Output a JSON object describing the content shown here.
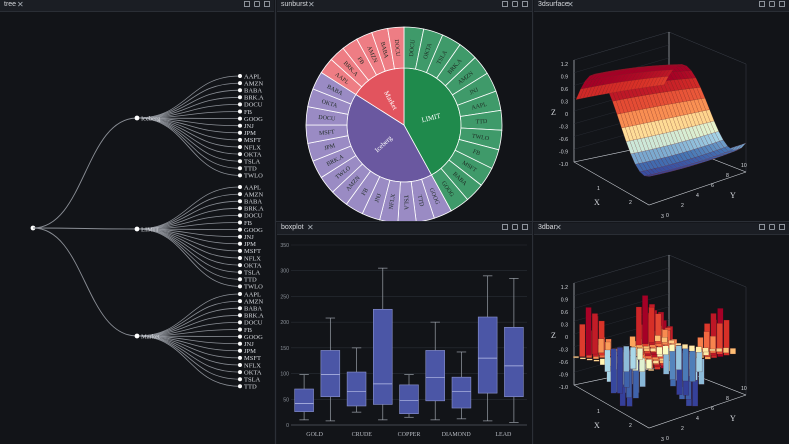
{
  "panels": {
    "tree": {
      "title": "tree"
    },
    "sunburst": {
      "title": "sunburst"
    },
    "surface": {
      "title": "3dsurface"
    },
    "boxplot": {
      "title": "boxplot"
    },
    "bar3d": {
      "title": "3dbar"
    }
  },
  "icons": [
    "close-icon",
    "restore-icon",
    "popout-icon",
    "maximize-icon"
  ],
  "chart_data": [
    {
      "type": "tree",
      "root": "",
      "branches": [
        {
          "name": "Iceberg",
          "children": [
            "AAPL",
            "AMZN",
            "BABA",
            "BRK.A",
            "DOCU",
            "FB",
            "GOOG",
            "JNJ",
            "JPM",
            "MSFT",
            "NFLX",
            "OKTA",
            "TSLA",
            "TTD",
            "TWLO"
          ]
        },
        {
          "name": "LIMIT",
          "children": [
            "AAPL",
            "AMZN",
            "BABA",
            "BRK.A",
            "DOCU",
            "FB",
            "GOOG",
            "JNJ",
            "JPM",
            "MSFT",
            "NFLX",
            "OKTA",
            "TSLA",
            "TTD",
            "TWLO"
          ]
        },
        {
          "name": "Market",
          "children": [
            "AAPL",
            "AMZN",
            "BABA",
            "BRK.A",
            "DOCU",
            "FB",
            "GOOG",
            "JNJ",
            "JPM",
            "MSFT",
            "NFLX",
            "OKTA",
            "TSLA",
            "TTD"
          ]
        }
      ]
    },
    {
      "type": "sunburst",
      "inner": [
        {
          "name": "LIMIT",
          "color": "#1f8a4c",
          "share": 0.42
        },
        {
          "name": "Iceberg",
          "color": "#6a58a0",
          "share": 0.42
        },
        {
          "name": "Market",
          "color": "#e2545e",
          "share": 0.16
        }
      ],
      "outer": [
        {
          "parent": "LIMIT",
          "color": "#3f9a6a",
          "labels": [
            "DOCU",
            "OKTA",
            "TSLA",
            "BRK.A",
            "AMZN",
            "JNJ",
            "AAPL",
            "TTD",
            "TWLO",
            "FB",
            "MSFT",
            "BABA",
            "GOOG"
          ]
        },
        {
          "parent": "Iceberg",
          "color": "#9a8bc4",
          "labels": [
            "GOOG",
            "TTD",
            "TSLA",
            "NFLX",
            "JNJ",
            "FB",
            "AMZN",
            "TWLO",
            "BRK.A",
            "JPM",
            "MSFT",
            "DOCU",
            "OKTA",
            "BABA"
          ]
        },
        {
          "parent": "Market",
          "color": "#ee7d84",
          "labels": [
            "AAPL",
            "BRK.A",
            "FB",
            "AMZN",
            "BABA",
            "DOCU"
          ]
        }
      ]
    },
    {
      "type": "surface",
      "zlabel": "Z",
      "xlabel": "X",
      "ylabel": "Y",
      "zticks": [
        "1.2",
        "0.9",
        "0.6",
        "0.3",
        "0",
        "-0.3",
        "-0.6",
        "-0.9",
        "-1.0"
      ],
      "xticks": [
        "1",
        "2",
        "3"
      ],
      "yticks": [
        "0",
        "2",
        "4",
        "6",
        "8",
        "10"
      ]
    },
    {
      "type": "box",
      "categories": [
        "GOLD",
        "CRUDE",
        "COPPER",
        "DIAMOND",
        "LEAD"
      ],
      "ylim": [
        0,
        350
      ],
      "yticks": [
        "350",
        "300",
        "250",
        "200",
        "150",
        "100",
        "50",
        "0"
      ],
      "boxes": [
        {
          "min": 10,
          "q1": 26,
          "median": 42,
          "q3": 70,
          "max": 98
        },
        {
          "min": 8,
          "q1": 55,
          "median": 98,
          "q3": 145,
          "max": 208
        },
        {
          "min": 25,
          "q1": 37,
          "median": 65,
          "q3": 103,
          "max": 150
        },
        {
          "min": 10,
          "q1": 40,
          "median": 80,
          "q3": 225,
          "max": 305
        },
        {
          "min": 15,
          "q1": 22,
          "median": 48,
          "q3": 78,
          "max": 98
        },
        {
          "min": 10,
          "q1": 47,
          "median": 92,
          "q3": 145,
          "max": 200
        },
        {
          "min": 12,
          "q1": 33,
          "median": 65,
          "q3": 93,
          "max": 142
        },
        {
          "min": 8,
          "q1": 62,
          "median": 130,
          "q3": 210,
          "max": 290
        },
        {
          "min": 5,
          "q1": 55,
          "median": 115,
          "q3": 190,
          "max": 285
        }
      ]
    },
    {
      "type": "bar3d",
      "zlabel": "Z",
      "xlabel": "X",
      "ylabel": "Y",
      "zticks": [
        "1.2",
        "0.9",
        "0.6",
        "0.3",
        "0",
        "-0.3",
        "-0.6",
        "-0.9",
        "-1.0"
      ],
      "xticks": [
        "1",
        "2",
        "3"
      ],
      "yticks": [
        "0",
        "2",
        "4",
        "6",
        "8",
        "10"
      ]
    }
  ]
}
